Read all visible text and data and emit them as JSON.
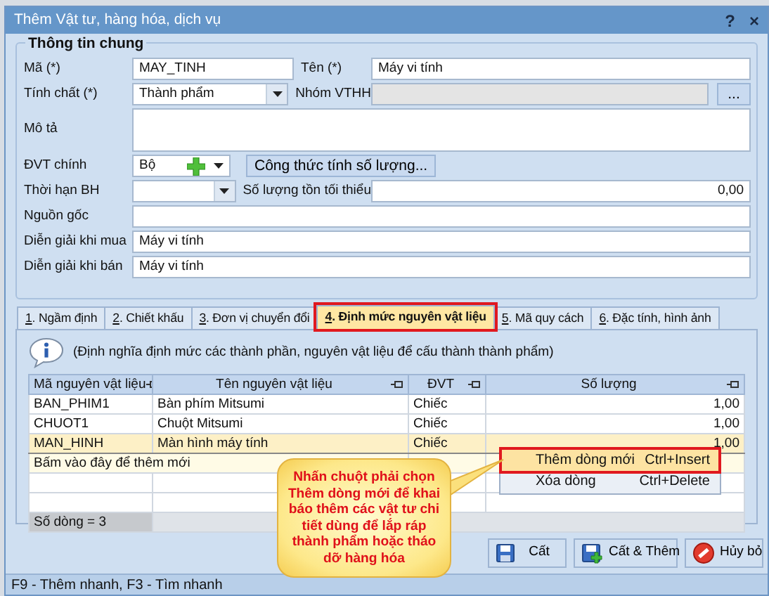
{
  "window": {
    "title": "Thêm Vật tư, hàng hóa, dịch vụ",
    "help": "?",
    "close": "×"
  },
  "general": {
    "title": "Thông tin chung",
    "rows": [
      {
        "label": "Mã (*)",
        "field": {
          "kind": "text",
          "value": "MAY_TINH"
        },
        "label2": "Tên (*)",
        "field2": {
          "kind": "text",
          "value": "Máy vi tính"
        }
      },
      {
        "label": "Tính chất (*)",
        "field": {
          "kind": "combo",
          "value": "Thành phẩm"
        },
        "label2": "Nhóm VTHH",
        "field2": {
          "kind": "lookup",
          "disabled": true,
          "button": "..."
        }
      },
      {
        "label": "Mô tả",
        "field": {
          "kind": "textarea"
        }
      },
      {
        "label": "ĐVT chính",
        "field": {
          "kind": "unit",
          "value": "Bộ"
        },
        "button": "Công thức tính số lượng..."
      },
      {
        "label": "Thời hạn BH",
        "field": {
          "kind": "combo"
        },
        "label2": "Số lượng tồn tối thiểu",
        "field2": {
          "kind": "number",
          "value": "0,00"
        }
      },
      {
        "label": "Nguồn gốc",
        "field": {
          "kind": "text"
        }
      },
      {
        "label": "Diễn giải khi mua",
        "field": {
          "kind": "text",
          "value": "Máy vi tính"
        }
      },
      {
        "label": "Diễn giải khi bán",
        "field": {
          "kind": "text",
          "value": "Máy vi tính"
        }
      }
    ]
  },
  "tabs": [
    {
      "label": "1. Ngầm định",
      "selected": false,
      "highlighted": false
    },
    {
      "label": "2. Chiết khấu",
      "selected": false,
      "highlighted": false
    },
    {
      "label": "3. Đơn vị chuyển đổi",
      "selected": false,
      "highlighted": false
    },
    {
      "label": "4. Định mức nguyên vật liệu",
      "selected": true,
      "highlighted": true
    },
    {
      "label": "5. Mã quy cách",
      "selected": false,
      "highlighted": false
    },
    {
      "label": "6. Đặc tính, hình ảnh",
      "selected": false,
      "highlighted": false
    }
  ],
  "info": "(Định nghĩa định mức các thành phần, nguyên vật liệu để cấu thành thành phẩm)",
  "table": {
    "columns": [
      "Mã nguyên vật liệu",
      "Tên nguyên vật liệu",
      "ĐVT",
      "Số lượng"
    ],
    "rows": [
      {
        "cells": [
          "BAN_PHIM1",
          "Bàn phím Mitsumi",
          "Chiếc",
          "1,00"
        ],
        "selected": false
      },
      {
        "cells": [
          "CHUOT1",
          "Chuột Mitsumi",
          "Chiếc",
          "1,00"
        ],
        "selected": false
      },
      {
        "cells": [
          "MAN_HINH",
          "Màn hình máy tính",
          "Chiếc",
          "1,00"
        ],
        "selected": true
      }
    ],
    "new_row_hint": "Bấm vào đây để thêm mới",
    "footer": "Số dòng = 3"
  },
  "context_menu": [
    {
      "label": "Thêm dòng mới",
      "shortcut": "Ctrl+Insert",
      "selected": true,
      "highlighted": true
    },
    {
      "label": "Xóa dòng",
      "shortcut": "Ctrl+Delete",
      "selected": false,
      "highlighted": false
    }
  ],
  "callout": "Nhấn chuột phải chọn Thêm dòng mới để khai báo thêm các vật tư chi tiết dùng để lắp ráp thành phẩm hoặc tháo dỡ hàng hóa",
  "buttons": [
    {
      "kind": "save",
      "label": "Cất"
    },
    {
      "kind": "save_add",
      "label": "Cất & Thêm"
    },
    {
      "kind": "cancel",
      "label": "Hủy bỏ"
    }
  ],
  "status_bar": "F9 - Thêm nhanh, F3 - Tìm nhanh"
}
